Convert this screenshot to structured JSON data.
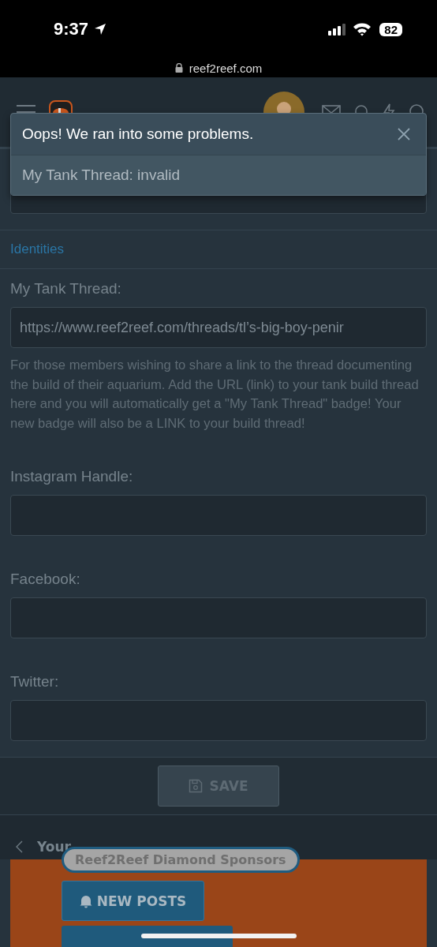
{
  "status_bar": {
    "time": "9:37",
    "battery": "82"
  },
  "browser": {
    "url": "reef2reef.com"
  },
  "alert": {
    "title": "Oops! We ran into some problems.",
    "message": "My Tank Thread: invalid"
  },
  "section_title": "Identities",
  "fields": [
    {
      "label": "My Tank Thread:",
      "value": "https://www.reef2reef.com/threads/tl’s-big-boy-penir",
      "help": "For those members wishing to share a link to the thread documenting the build of their aquarium. Add the URL (link) to your tank build thread here and you will automatically get a \"My Tank Thread\" badge! Your new badge will also be a LINK to your build thread!"
    },
    {
      "label": "Instagram Handle:"
    },
    {
      "label": "Facebook:"
    },
    {
      "label": "Twitter:"
    }
  ],
  "save_button": {
    "label": "SAVE",
    "disabled": true
  },
  "breadcrumb": "Your",
  "sponsors": {
    "title": "Reef2Reef Diamond Sponsors",
    "buttons": [
      "NEW POSTS"
    ]
  }
}
